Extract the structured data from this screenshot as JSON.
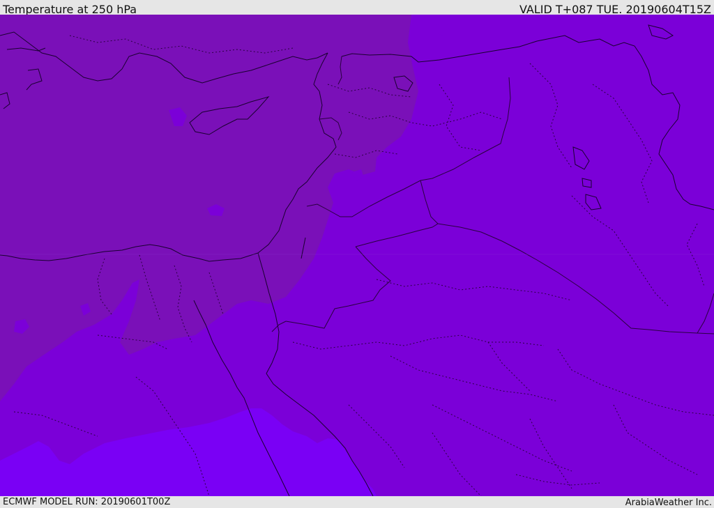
{
  "header": {
    "title": "Temperature at 250 hPa",
    "valid_time": "VALID T+087 TUE. 20190604T15Z"
  },
  "footer": {
    "model_run": "ECMWF MODEL RUN: 20190601T00Z",
    "credit": "ArabiaWeather Inc."
  },
  "colors": {
    "band_warm": "#7a10b8",
    "band_mid": "#7b00d8",
    "band_cool": "#7a00f5",
    "coastline": "#1a0030",
    "border_line": "#2a0040"
  }
}
